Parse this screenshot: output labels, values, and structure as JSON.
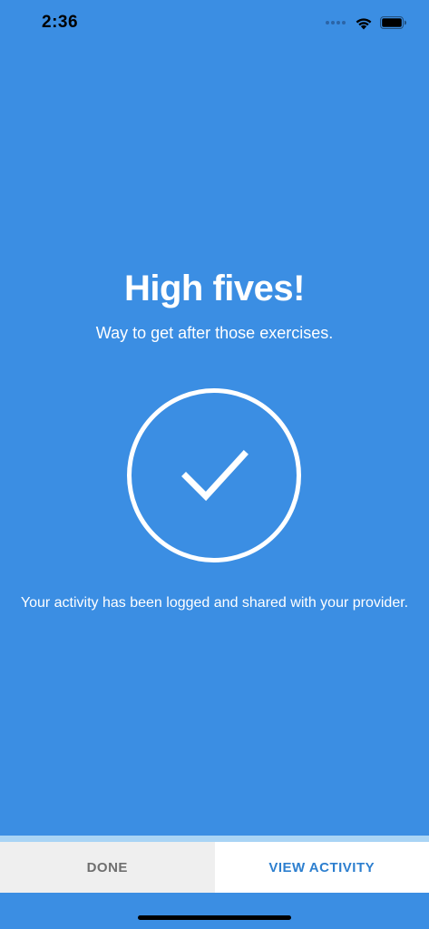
{
  "status_bar": {
    "time": "2:36",
    "icons": [
      "cellular-signal-icon",
      "wifi-icon",
      "battery-icon"
    ]
  },
  "main": {
    "headline": "High fives!",
    "subheadline": "Way to get after those exercises.",
    "status_icon": "checkmark-circle-icon",
    "message": "Your activity has been logged and shared with your provider."
  },
  "actions": {
    "done_label": "DONE",
    "view_activity_label": "VIEW ACTIVITY"
  },
  "colors": {
    "background": "#3b8ee3",
    "accent_text": "#2d7fcf",
    "done_background": "#efefef",
    "done_text": "#6f6f6f",
    "strip": "#a9d4f5"
  }
}
